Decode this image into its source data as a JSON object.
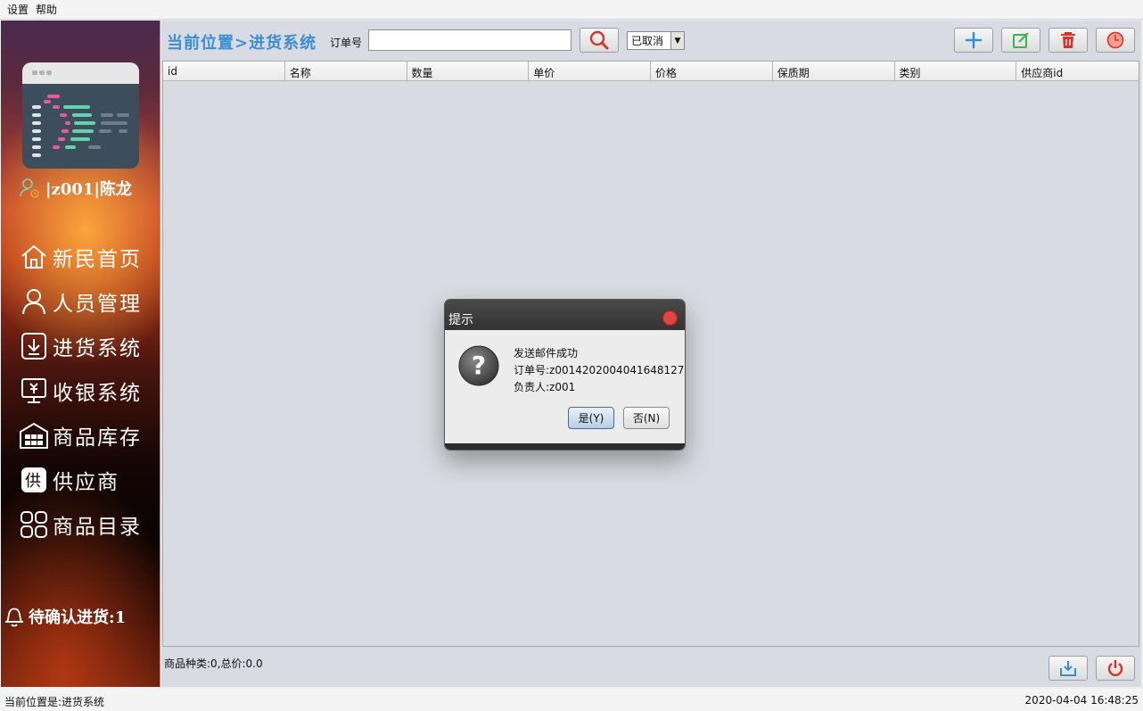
{
  "menu": {
    "settings": "设置",
    "help": "帮助"
  },
  "sidebar": {
    "user": "|z001|陈龙",
    "nav": [
      {
        "label": "新民首页",
        "icon": "home-icon"
      },
      {
        "label": "人员管理",
        "icon": "person-icon"
      },
      {
        "label": "进货系统",
        "icon": "download-icon"
      },
      {
        "label": "收银系统",
        "icon": "cashier-icon"
      },
      {
        "label": "商品库存",
        "icon": "warehouse-icon"
      },
      {
        "label": "供应商",
        "icon": "supplier-icon"
      },
      {
        "label": "商品目录",
        "icon": "grid-icon"
      }
    ],
    "pending": "待确认进货:1"
  },
  "toolbar": {
    "location": "当前位置>进货系统",
    "order_label": "订单号",
    "order_value": "",
    "status_select": "已取消"
  },
  "table": {
    "columns": [
      "id",
      "名称",
      "数量",
      "单价",
      "价格",
      "保质期",
      "类别",
      "供应商id"
    ],
    "rows": []
  },
  "summary": "商品种类:0,总价:0.0",
  "statusbar": {
    "left": "当前位置是:进货系统",
    "right": "2020-04-04 16:48:25"
  },
  "dialog": {
    "title": "提示",
    "lines": [
      "发送邮件成功",
      "订单号:z0014202004041648127",
      "负责人:z001"
    ],
    "yes": "是(Y)",
    "no": "否(N)"
  },
  "colors": {
    "location": "#3a8ed2",
    "add": "#2f8fd8",
    "edit": "#3cb64a",
    "delete": "#d9342b",
    "close": "#e0453f"
  }
}
